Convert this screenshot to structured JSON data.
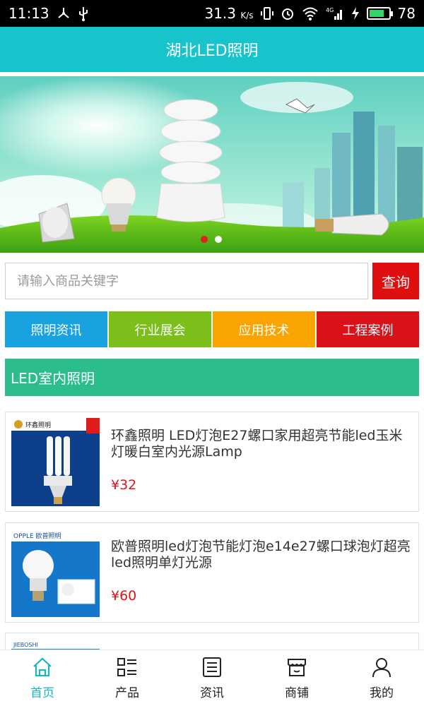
{
  "status_bar": {
    "time": "11:13",
    "speed": "31.3",
    "speed_unit": "K/s",
    "network": "4G",
    "battery": "78",
    "battery_level": 0.78
  },
  "header": {
    "title": "湖北LED照明"
  },
  "banner": {
    "slide_count": 2,
    "active_index": 0
  },
  "search": {
    "placeholder": "请输入商品关键字",
    "button_label": "查询"
  },
  "categories": [
    {
      "label": "照明资讯",
      "color": "#18a3e0"
    },
    {
      "label": "行业展会",
      "color": "#7cbf1a"
    },
    {
      "label": "应用技术",
      "color": "#f9a400"
    },
    {
      "label": "工程案例",
      "color": "#d9121a"
    }
  ],
  "section": {
    "title": "LED室内照明"
  },
  "products": [
    {
      "title": "环鑫照明 LED灯泡E27螺口家用超亮节能led玉米灯暖白室内光源Lamp",
      "price": "¥32",
      "brand": "环鑫照明"
    },
    {
      "title": "欧普照明led灯泡节能灯泡e14e27螺口球泡灯超亮led照明单灯光源",
      "price": "¥60",
      "brand": "OPPLE 欧普照明"
    },
    {
      "title": "",
      "price": "",
      "brand": "JIEBOSHI"
    }
  ],
  "bottom_nav": [
    {
      "label": "首页",
      "icon": "home-icon",
      "active": true
    },
    {
      "label": "产品",
      "icon": "grid-list-icon",
      "active": false
    },
    {
      "label": "资讯",
      "icon": "news-icon",
      "active": false
    },
    {
      "label": "商铺",
      "icon": "shop-icon",
      "active": false
    },
    {
      "label": "我的",
      "icon": "user-icon",
      "active": false
    }
  ],
  "colors": {
    "accent": "#18c4cc",
    "section": "#2bbd8b",
    "price": "#e0141b",
    "search_button": "#e00f0f",
    "nav_active": "#18b4c8"
  }
}
